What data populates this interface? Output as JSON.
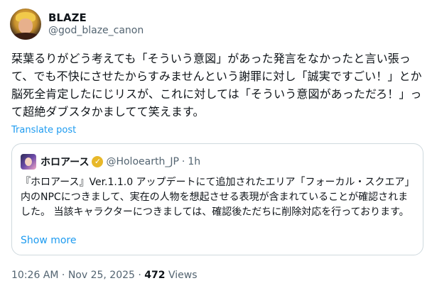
{
  "author": {
    "display_name": "BLAZE",
    "handle": "@god_blaze_canon"
  },
  "post": {
    "text": "栞葉るりがどう考えても「そういう意図」があった発言をなかったと言い張って、でも不快にさせたからすみませんという謝罪に対し「誠実ですごい！」とか脳死全肯定したにじリスが、これに対しては「そういう意図があっただろ！」って超絶ダブスタかましてて笑えます。",
    "translate_label": "Translate post"
  },
  "quote": {
    "name": "ホロアース",
    "handle": "@Holoearth_JP",
    "separator": "·",
    "time": "1h",
    "text": "『ホロアース』Ver.1.1.0 アップデートにて追加されたエリア「フォーカル・スクエア」内のNPCにつきまして、実在の人物を想起させる表現が含まれていることが確認されました。 当該キャラクターにつきましては、確認後ただちに削除対応を行っております。",
    "show_more": "Show more",
    "verified_icon": "gold-check-badge"
  },
  "meta": {
    "time": "10:26 AM",
    "sep1": "·",
    "date": "Nov 25, 2025",
    "sep2": "·",
    "views_count": "472",
    "views_label": "Views"
  },
  "colors": {
    "link": "#1d9bf0",
    "secondary": "#536471",
    "border": "#cfd9de",
    "verified": "#e8b829"
  }
}
